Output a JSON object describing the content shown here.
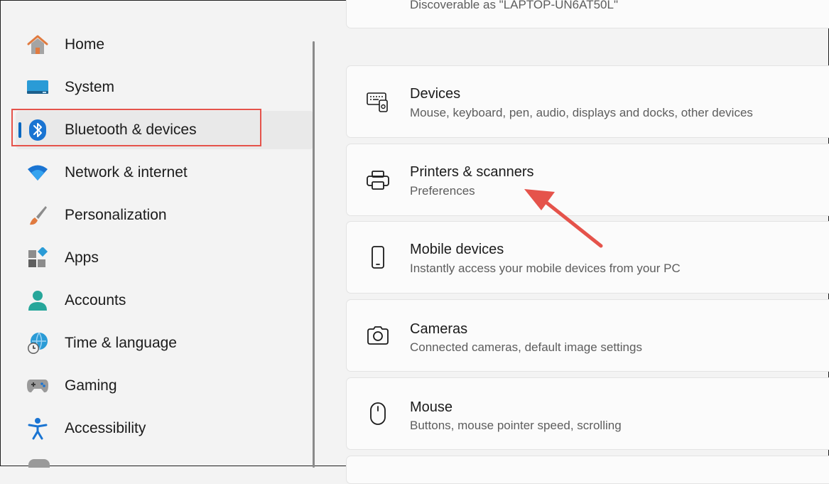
{
  "sidebar": {
    "items": [
      {
        "label": "Home",
        "icon": "home-icon"
      },
      {
        "label": "System",
        "icon": "system-monitor-icon"
      },
      {
        "label": "Bluetooth & devices",
        "icon": "bluetooth-icon",
        "selected": true
      },
      {
        "label": "Network & internet",
        "icon": "wifi-icon"
      },
      {
        "label": "Personalization",
        "icon": "paintbrush-icon"
      },
      {
        "label": "Apps",
        "icon": "apps-icon"
      },
      {
        "label": "Accounts",
        "icon": "account-icon"
      },
      {
        "label": "Time & language",
        "icon": "globe-clock-icon"
      },
      {
        "label": "Gaming",
        "icon": "gamepad-icon"
      },
      {
        "label": "Accessibility",
        "icon": "accessibility-icon"
      }
    ]
  },
  "main": {
    "partial_top_text": "Discoverable as \"LAPTOP-UN6AT50L\"",
    "cards": [
      {
        "title": "Devices",
        "subtitle": "Mouse, keyboard, pen, audio, displays and docks, other devices",
        "icon": "devices-icon"
      },
      {
        "title": "Printers & scanners",
        "subtitle": "Preferences",
        "icon": "printer-icon"
      },
      {
        "title": "Mobile devices",
        "subtitle": "Instantly access your mobile devices from your PC",
        "icon": "phone-icon"
      },
      {
        "title": "Cameras",
        "subtitle": "Connected cameras, default image settings",
        "icon": "camera-icon"
      },
      {
        "title": "Mouse",
        "subtitle": "Buttons, mouse pointer speed, scrolling",
        "icon": "mouse-icon"
      }
    ]
  },
  "colors": {
    "accent": "#0067c0",
    "annotation": "#e5534b"
  }
}
